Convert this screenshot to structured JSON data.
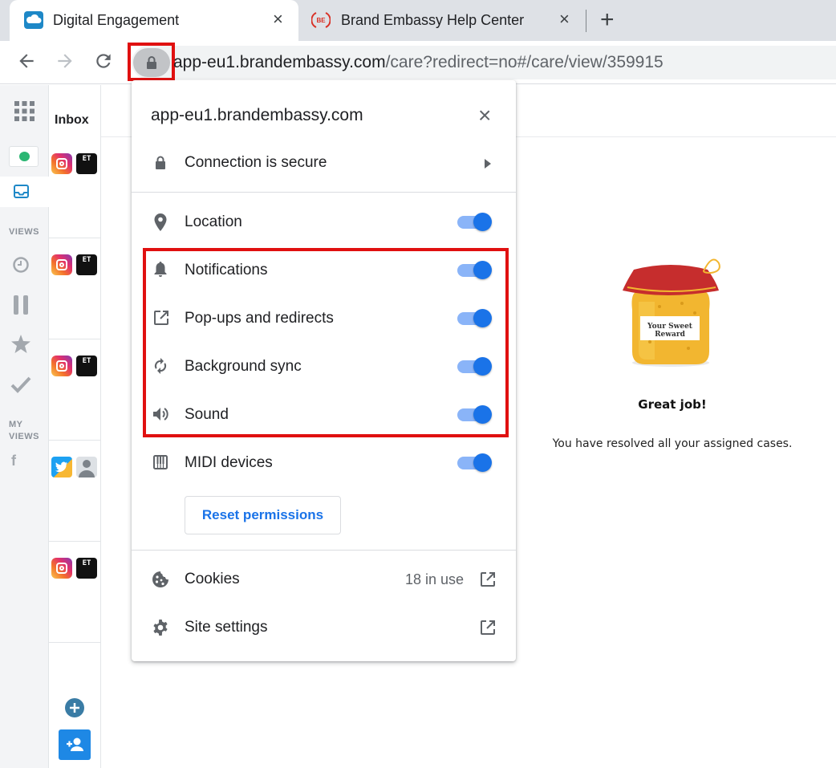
{
  "browser": {
    "tabs": [
      {
        "title": "Digital Engagement",
        "icon": "cloud-icon",
        "close": "×",
        "active": true
      },
      {
        "title": "Brand Embassy Help Center",
        "icon": "be-logo-icon",
        "close": "×",
        "active": false
      }
    ],
    "new_tab": "+",
    "url_host": "app-eu1.brandembassy.com",
    "url_path": "/care?redirect=no#/care/view/359915"
  },
  "sidebar": {
    "views_label": "VIEWS",
    "my_views_label_1": "MY",
    "my_views_label_2": "VIEWS",
    "facebook_glyph": "f"
  },
  "inbox": {
    "title": "Inbox",
    "avatar_text": "ET"
  },
  "main": {
    "jar_label_1": "Your Sweet",
    "jar_label_2": "Reward",
    "headline": "Great job!",
    "message": "You have resolved all your assigned cases."
  },
  "site_info": {
    "domain": "app-eu1.brandembassy.com",
    "close": "×",
    "connection": "Connection is secure",
    "permissions": [
      {
        "label": "Location",
        "icon": "location-pin-icon",
        "enabled": true
      },
      {
        "label": "Notifications",
        "icon": "bell-icon",
        "enabled": true
      },
      {
        "label": "Pop-ups and redirects",
        "icon": "popup-icon",
        "enabled": true
      },
      {
        "label": "Background sync",
        "icon": "sync-icon",
        "enabled": true
      },
      {
        "label": "Sound",
        "icon": "speaker-icon",
        "enabled": true
      },
      {
        "label": "MIDI devices",
        "icon": "midi-icon",
        "enabled": true
      }
    ],
    "reset_button": "Reset permissions",
    "cookies_label": "Cookies",
    "cookies_count": "18 in use",
    "site_settings_label": "Site settings"
  },
  "colors": {
    "accent_blue": "#1a73e8",
    "toggle_track": "#8ab4f8",
    "highlight_red": "#e01010",
    "app_teal": "#1e88c7"
  }
}
